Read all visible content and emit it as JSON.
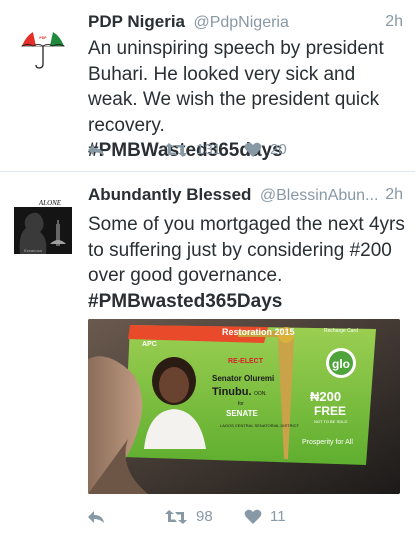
{
  "tweets": [
    {
      "name": "PDP Nigeria",
      "handle": "@PdpNigeria",
      "time": "2h",
      "text": "An uninspiring speech by president Buhari. He looked very sick and weak. We wish the president quick recovery.",
      "hashtag": "#PMBWasted365days",
      "retweets": "131",
      "likes": "20",
      "avatar_logo": "PDP"
    },
    {
      "name": "Abundantly Blessed",
      "handle": "@BlessinAbun...",
      "time": "2h",
      "text": "Some of you mortgaged the next 4yrs to suffering just by considering #200 over good governance.",
      "hashtag": "#PMBwasted365Days",
      "retweets": "98",
      "likes": "11",
      "avatar_text": "ALONE",
      "avatar_caption": "Ezeanosa",
      "card": {
        "top_banner": "Restoration 2015",
        "recharge_label": "Recharge Card",
        "party": "APC",
        "reelect": "RE-ELECT",
        "candidate_line1": "Senator Oluremi",
        "candidate_line2": "Tinubu.",
        "candidate_suffix": "OON.",
        "for_label": "for",
        "office": "SENATE",
        "district": "LAGOS CENTRAL SENATORIAL DISTRICT",
        "carrier": "glo",
        "amount": "₦200",
        "free": "FREE",
        "not_sold": "NOT TO BE SOLD",
        "slogan": "Prosperity for All"
      }
    }
  ],
  "colors": {
    "text": "#292f33",
    "muted": "#8899a6",
    "divider": "#e1e8ed",
    "card_green": "#7dc242",
    "glo_green": "#4fa33b"
  },
  "icons": [
    "umbrella-logo-icon",
    "reply-icon",
    "retweet-icon",
    "heart-icon"
  ]
}
